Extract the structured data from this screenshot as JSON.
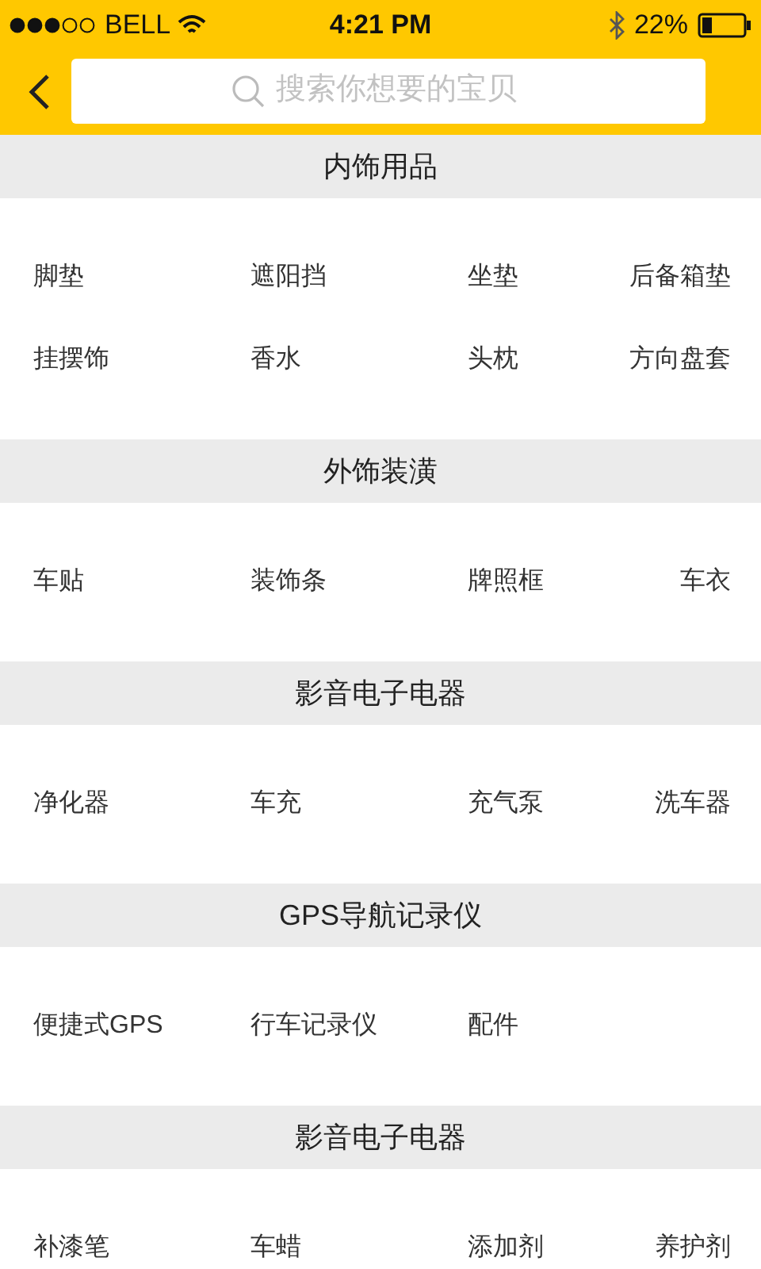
{
  "status_bar": {
    "carrier": "BELL",
    "time": "4:21 PM",
    "battery": "22%"
  },
  "search": {
    "placeholder": "搜索你想要的宝贝"
  },
  "sections": [
    {
      "title": "内饰用品",
      "items": [
        "脚垫",
        "遮阳挡",
        "坐垫",
        "后备箱垫",
        "挂摆饰",
        "香水",
        "头枕",
        "方向盘套"
      ]
    },
    {
      "title": "外饰装潢",
      "items": [
        "车贴",
        "装饰条",
        "牌照框",
        "车衣"
      ]
    },
    {
      "title": "影音电子电器",
      "items": [
        "净化器",
        "车充",
        "充气泵",
        "洗车器"
      ]
    },
    {
      "title": "GPS导航记录仪",
      "items": [
        "便捷式GPS",
        "行车记录仪",
        "配件"
      ]
    },
    {
      "title": "影音电子电器",
      "items": [
        "补漆笔",
        "车蜡",
        "添加剂",
        "养护剂"
      ]
    }
  ]
}
